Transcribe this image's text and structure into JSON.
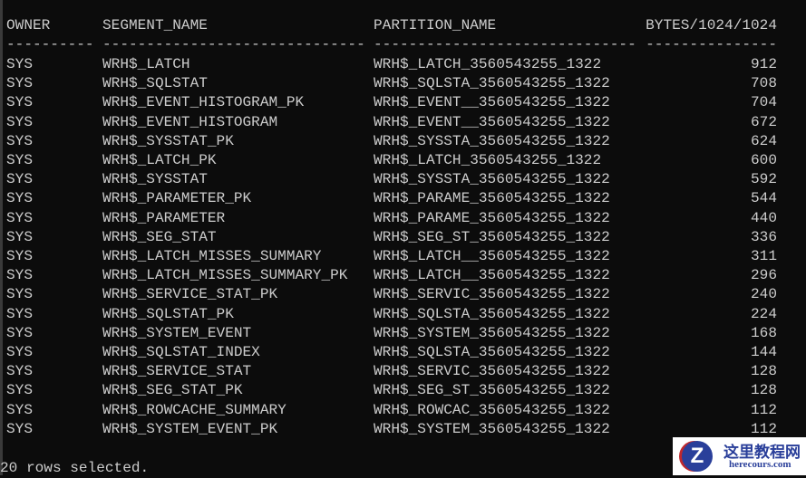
{
  "headers": {
    "owner": "OWNER",
    "segment": "SEGMENT_NAME",
    "partition": "PARTITION_NAME",
    "bytes": "BYTES/1024/1024"
  },
  "separators": {
    "owner": "----------",
    "segment": "------------------------------",
    "partition": "------------------------------",
    "bytes": "---------------"
  },
  "rows": [
    {
      "owner": "SYS",
      "segment": "WRH$_LATCH",
      "partition": "WRH$_LATCH_3560543255_1322",
      "bytes": "912"
    },
    {
      "owner": "SYS",
      "segment": "WRH$_SQLSTAT",
      "partition": "WRH$_SQLSTA_3560543255_1322",
      "bytes": "708"
    },
    {
      "owner": "SYS",
      "segment": "WRH$_EVENT_HISTOGRAM_PK",
      "partition": "WRH$_EVENT__3560543255_1322",
      "bytes": "704"
    },
    {
      "owner": "SYS",
      "segment": "WRH$_EVENT_HISTOGRAM",
      "partition": "WRH$_EVENT__3560543255_1322",
      "bytes": "672"
    },
    {
      "owner": "SYS",
      "segment": "WRH$_SYSSTAT_PK",
      "partition": "WRH$_SYSSTA_3560543255_1322",
      "bytes": "624"
    },
    {
      "owner": "SYS",
      "segment": "WRH$_LATCH_PK",
      "partition": "WRH$_LATCH_3560543255_1322",
      "bytes": "600"
    },
    {
      "owner": "SYS",
      "segment": "WRH$_SYSSTAT",
      "partition": "WRH$_SYSSTA_3560543255_1322",
      "bytes": "592"
    },
    {
      "owner": "SYS",
      "segment": "WRH$_PARAMETER_PK",
      "partition": "WRH$_PARAME_3560543255_1322",
      "bytes": "544"
    },
    {
      "owner": "SYS",
      "segment": "WRH$_PARAMETER",
      "partition": "WRH$_PARAME_3560543255_1322",
      "bytes": "440"
    },
    {
      "owner": "SYS",
      "segment": "WRH$_SEG_STAT",
      "partition": "WRH$_SEG_ST_3560543255_1322",
      "bytes": "336"
    },
    {
      "owner": "SYS",
      "segment": "WRH$_LATCH_MISSES_SUMMARY",
      "partition": "WRH$_LATCH__3560543255_1322",
      "bytes": "311"
    },
    {
      "owner": "SYS",
      "segment": "WRH$_LATCH_MISSES_SUMMARY_PK",
      "partition": "WRH$_LATCH__3560543255_1322",
      "bytes": "296"
    },
    {
      "owner": "SYS",
      "segment": "WRH$_SERVICE_STAT_PK",
      "partition": "WRH$_SERVIC_3560543255_1322",
      "bytes": "240"
    },
    {
      "owner": "SYS",
      "segment": "WRH$_SQLSTAT_PK",
      "partition": "WRH$_SQLSTA_3560543255_1322",
      "bytes": "224"
    },
    {
      "owner": "SYS",
      "segment": "WRH$_SYSTEM_EVENT",
      "partition": "WRH$_SYSTEM_3560543255_1322",
      "bytes": "168"
    },
    {
      "owner": "SYS",
      "segment": "WRH$_SQLSTAT_INDEX",
      "partition": "WRH$_SQLSTA_3560543255_1322",
      "bytes": "144"
    },
    {
      "owner": "SYS",
      "segment": "WRH$_SERVICE_STAT",
      "partition": "WRH$_SERVIC_3560543255_1322",
      "bytes": "128"
    },
    {
      "owner": "SYS",
      "segment": "WRH$_SEG_STAT_PK",
      "partition": "WRH$_SEG_ST_3560543255_1322",
      "bytes": "128"
    },
    {
      "owner": "SYS",
      "segment": "WRH$_ROWCACHE_SUMMARY",
      "partition": "WRH$_ROWCAC_3560543255_1322",
      "bytes": "112"
    },
    {
      "owner": "SYS",
      "segment": "WRH$_SYSTEM_EVENT_PK",
      "partition": "WRH$_SYSTEM_3560543255_1322",
      "bytes": "112"
    }
  ],
  "footer": "20 rows selected.",
  "watermark": {
    "logo_letter": "Z",
    "title": "这里教程网",
    "url": "herecours.com"
  }
}
